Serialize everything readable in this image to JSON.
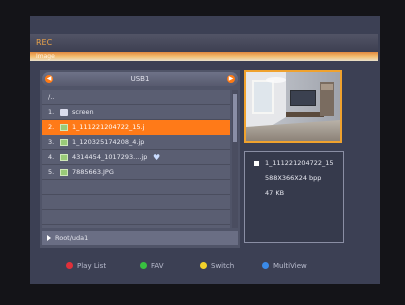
{
  "header": {
    "title": "REC",
    "subtitle": "Image"
  },
  "device": {
    "name": "USB1",
    "prev_icon": "left-arrow-icon",
    "next_icon": "right-arrow-icon"
  },
  "files": [
    {
      "num": "",
      "name": "/..",
      "type": "parent"
    },
    {
      "num": "1.",
      "name": "screen",
      "type": "folder"
    },
    {
      "num": "2.",
      "name": "1_111221204722_15.j",
      "type": "image",
      "selected": true
    },
    {
      "num": "3.",
      "name": "1_120325174208_4.jp",
      "type": "image"
    },
    {
      "num": "4.",
      "name": "4314454_1017293....jp",
      "type": "image",
      "favorite": true
    },
    {
      "num": "5.",
      "name": "7885663.JPG",
      "type": "image"
    }
  ],
  "path": "Root/uda1",
  "info": {
    "name": "1_111221204722_15",
    "resolution": "588X366X24 bpp",
    "size": "47 KB"
  },
  "footer": [
    {
      "label": "Play List",
      "color": "#e0303a"
    },
    {
      "label": "FAV",
      "color": "#38c040"
    },
    {
      "label": "Switch",
      "color": "#f2d22a"
    },
    {
      "label": "MultiView",
      "color": "#3a8ae8"
    }
  ],
  "colors": {
    "accent": "#ff7a18",
    "preview_border": "#f0a22e"
  }
}
